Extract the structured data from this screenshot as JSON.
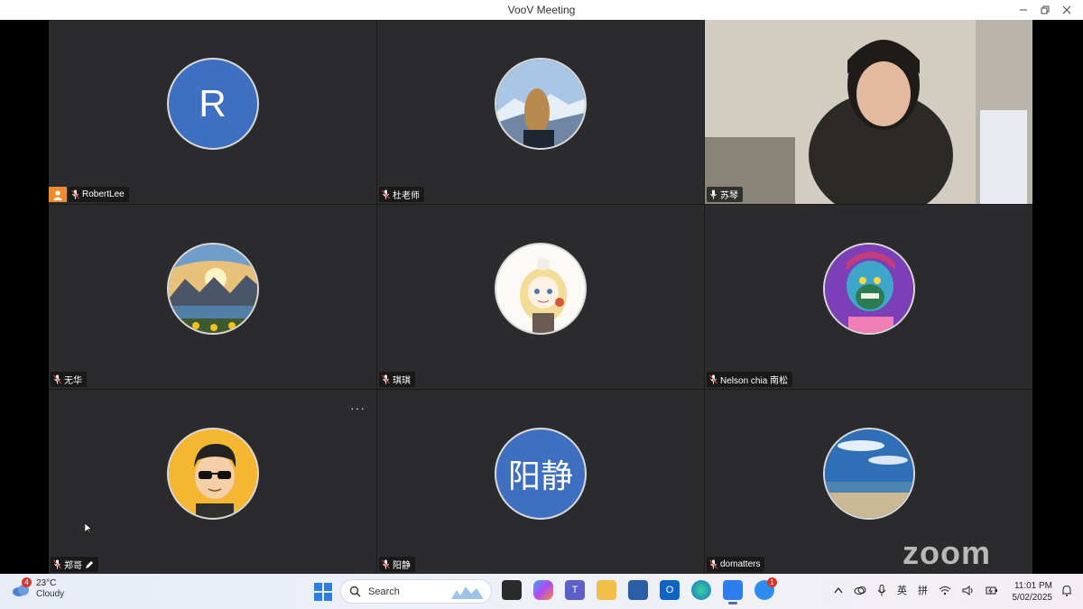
{
  "window": {
    "title": "VooV Meeting"
  },
  "participants": [
    {
      "name": "RobertLee",
      "avatar_text": "R",
      "avatar_type": "letter",
      "host": true
    },
    {
      "name": "杜老师",
      "avatar_type": "photo-mountain-hair"
    },
    {
      "name": "苏琴",
      "avatar_type": "video",
      "active_speaker": true
    },
    {
      "name": "无华",
      "avatar_type": "photo-landscape"
    },
    {
      "name": "琪琪",
      "avatar_type": "cartoon-girl"
    },
    {
      "name": "Nelson chia 南松",
      "avatar_type": "cartoon-ape"
    },
    {
      "name": "郑哥",
      "avatar_type": "cartoon-sunglasses",
      "editing": true
    },
    {
      "name": "阳静",
      "avatar_text": "阳静",
      "avatar_type": "letter"
    },
    {
      "name": "domatters",
      "avatar_type": "photo-beach"
    }
  ],
  "more_label": "···",
  "watermark": "zoom",
  "taskbar": {
    "weather": {
      "temp": "23°C",
      "condition": "Cloudy",
      "badge": "4"
    },
    "search_placeholder": "Search",
    "tray": {
      "ime_1": "英",
      "ime_2": "拼"
    },
    "clock": {
      "time": "11:01 PM",
      "date": "5/02/2025"
    },
    "app_badge": "1"
  },
  "colors": {
    "tile_bg": "#2b2b2d",
    "active_border": "#2ecc71",
    "avatar_blue": "#3e6fc0",
    "host_orange": "#f08c2e"
  }
}
